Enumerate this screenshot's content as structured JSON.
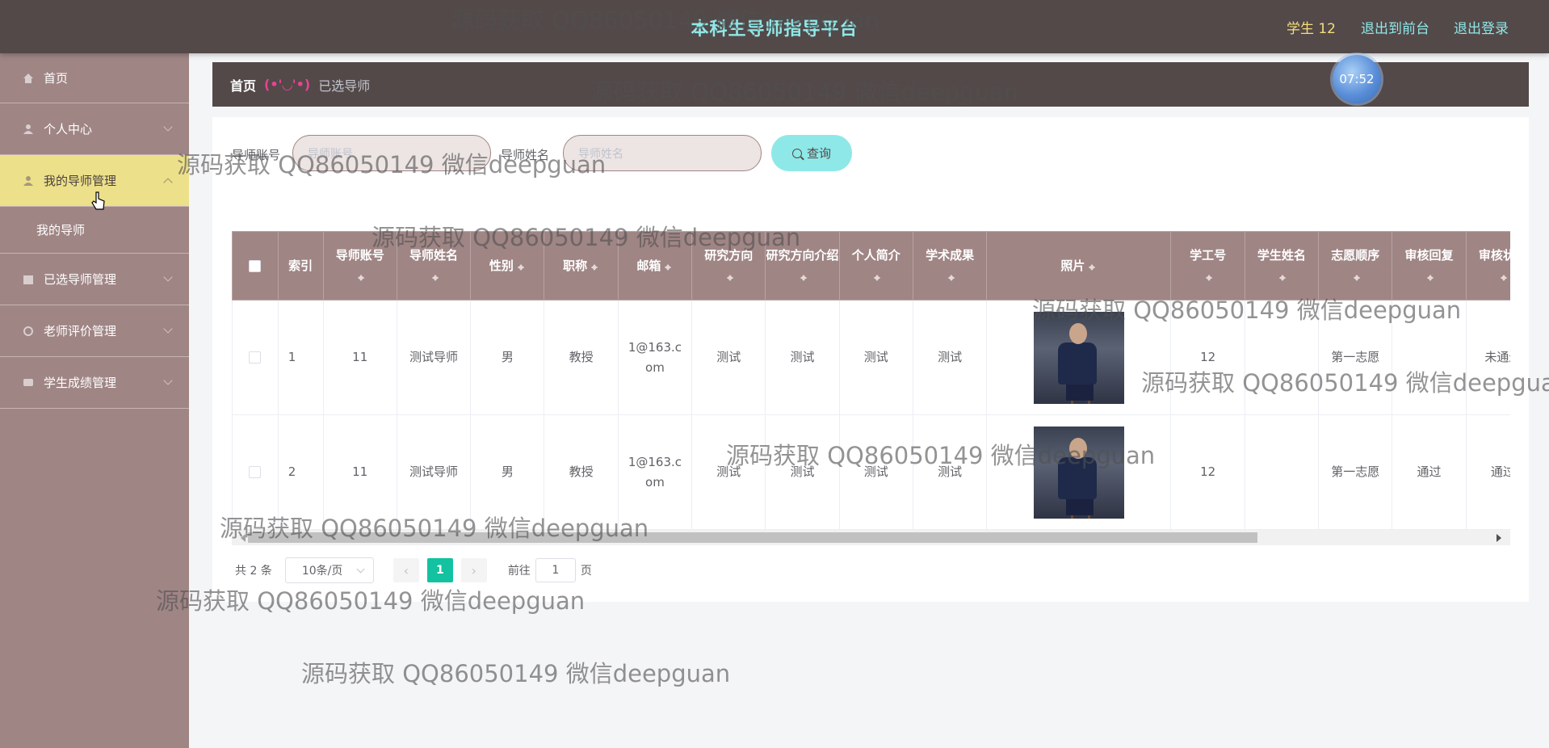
{
  "header": {
    "title": "本科生导师指导平台",
    "user": "学生 12",
    "front_link": "退出到前台",
    "logout_link": "退出登录"
  },
  "sidebar": {
    "items": [
      {
        "label": "首页"
      },
      {
        "label": "个人中心"
      },
      {
        "label": "我的导师管理"
      },
      {
        "label": "已选导师管理"
      },
      {
        "label": "老师评价管理"
      },
      {
        "label": "学生成绩管理"
      }
    ],
    "submenu": [
      {
        "label": "我的导师"
      }
    ]
  },
  "breadcrumb": {
    "home": "首页",
    "face": "(•'◡'•)",
    "current": "已选导师"
  },
  "clock": "07:52",
  "search": {
    "account_label": "导师账号",
    "account_placeholder": "导师账号",
    "name_label": "导师姓名",
    "name_placeholder": "导师姓名",
    "button": "查询"
  },
  "table": {
    "headers": [
      "索引",
      "导师账号",
      "导师姓名",
      "性别",
      "职称",
      "邮箱",
      "研究方向",
      "研究方向介绍",
      "个人简介",
      "学术成果",
      "照片",
      "学工号",
      "学生姓名",
      "志愿顺序",
      "审核回复",
      "审核状态"
    ],
    "rows": [
      {
        "index": "1",
        "account": "11",
        "name": "测试导师",
        "gender": "男",
        "title": "教授",
        "email": "1@163.com",
        "direction": "测试",
        "direction_intro": "测试",
        "bio": "测试",
        "achievement": "测试",
        "student_id": "12",
        "student_name": "",
        "order": "第一志愿",
        "reply": "",
        "status": "未通过"
      },
      {
        "index": "2",
        "account": "11",
        "name": "测试导师",
        "gender": "男",
        "title": "教授",
        "email": "1@163.com",
        "direction": "测试",
        "direction_intro": "测试",
        "bio": "测试",
        "achievement": "测试",
        "student_id": "12",
        "student_name": "",
        "order": "第一志愿",
        "reply": "通过",
        "status": "通过"
      }
    ]
  },
  "pagination": {
    "total": "共 2 条",
    "page_size": "10条/页",
    "current_page": "1",
    "goto_prefix": "前往",
    "goto_value": "1",
    "goto_suffix": "页"
  },
  "watermark": "源码获取 QQ86050149 微信deepguan"
}
